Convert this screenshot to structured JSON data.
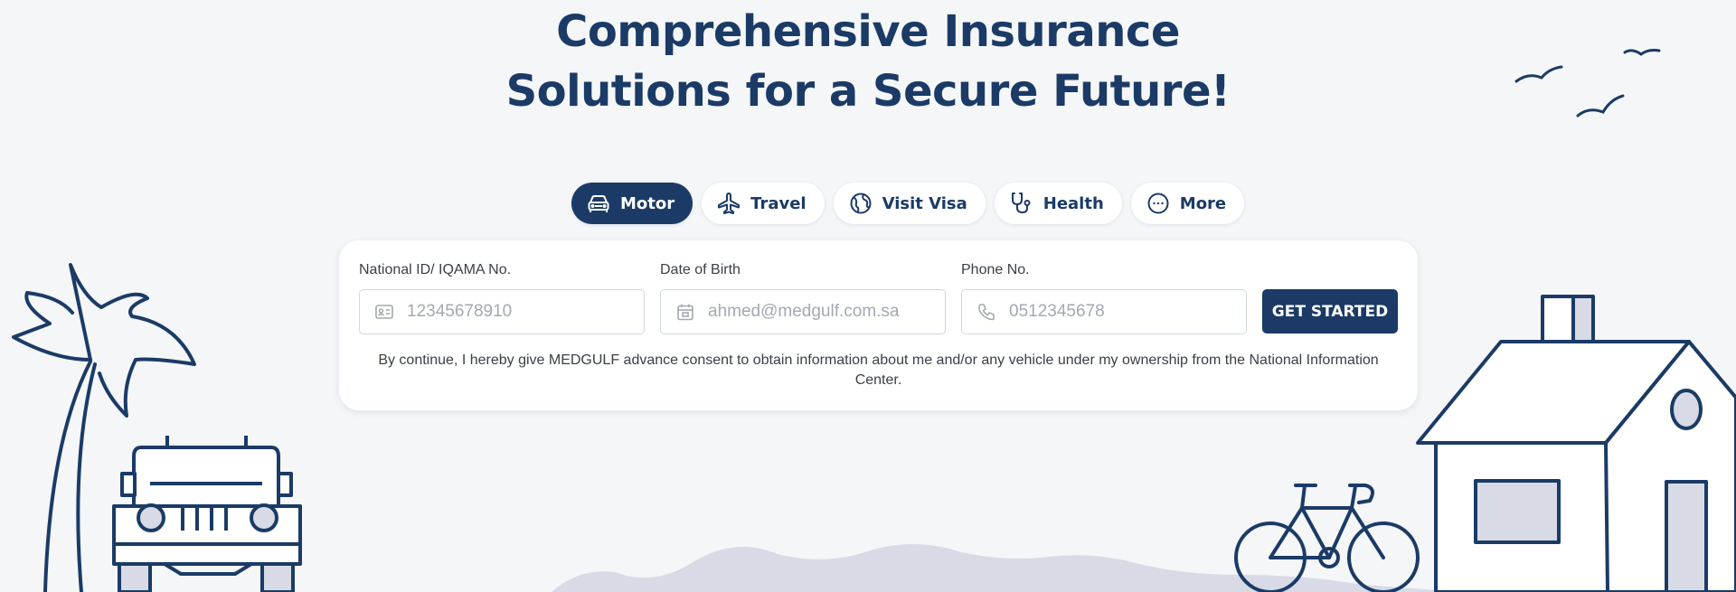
{
  "hero": {
    "title_line1": "Comprehensive Insurance",
    "title_line2": "Solutions for a Secure Future!"
  },
  "tabs": [
    {
      "label": "Motor",
      "icon": "car-icon",
      "active": true
    },
    {
      "label": "Travel",
      "icon": "airplane-icon",
      "active": false
    },
    {
      "label": "Visit Visa",
      "icon": "globe-icon",
      "active": false
    },
    {
      "label": "Health",
      "icon": "stethoscope-icon",
      "active": false
    },
    {
      "label": "More",
      "icon": "more-dots-icon",
      "active": false
    }
  ],
  "form": {
    "national_id": {
      "label": "National ID/ IQAMA No.",
      "placeholder": "12345678910",
      "icon": "id-card-icon"
    },
    "dob": {
      "label": "Date of Birth",
      "placeholder": "ahmed@medgulf.com.sa",
      "icon": "calendar-icon"
    },
    "phone": {
      "label": "Phone No.",
      "placeholder": "0512345678",
      "icon": "phone-icon"
    },
    "submit_label": "GET STARTED",
    "consent_text": "By continue, I hereby give MEDGULF advance consent to obtain information about me and/or any vehicle under my ownership from the National Information Center."
  },
  "colors": {
    "primary": "#1b3b66",
    "background": "#f4f6f8",
    "illustration_fill": "#d8dbe6"
  }
}
